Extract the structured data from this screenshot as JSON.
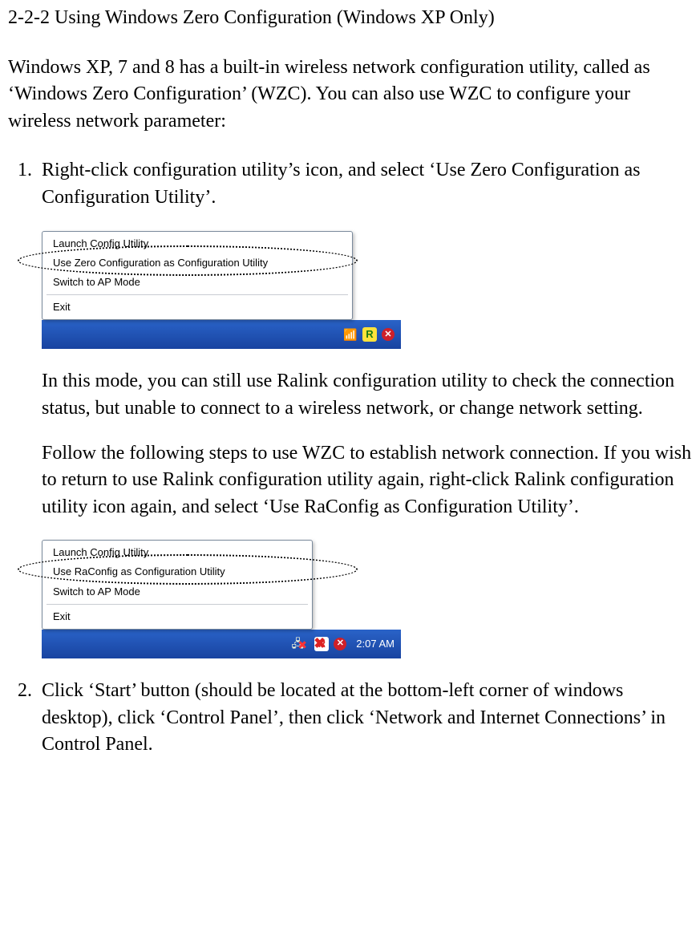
{
  "title": "2-2-2 Using Windows Zero Configuration (Windows XP Only)",
  "intro": "Windows XP, 7 and 8 has a built-in wireless network configuration utility, called as ‘Windows Zero Configuration’ (WZC). You can also use WZC to configure your wireless network parameter:",
  "steps": {
    "one": {
      "text": "Right-click configuration utility’s icon, and select ‘Use Zero Configuration as Configuration Utility’.",
      "menu": {
        "launch": "Launch Config Utility",
        "useZero": "Use Zero Configuration as Configuration Utility",
        "switchAP": "Switch to AP Mode",
        "exit": "Exit"
      },
      "tray": {
        "r_label": "R"
      },
      "after1": "In this mode, you can still use Ralink configuration utility to check the connection status, but unable to connect to a wireless network, or change network setting.",
      "after2": "Follow the following steps to use WZC to establish network connection. If you wish to return to use Ralink configuration utility again, right-click Ralink configuration utility icon again, and select ‘Use RaConfig as Configuration Utility’.",
      "menu2": {
        "launch": "Launch Config Utility",
        "useRa": "Use RaConfig as Configuration Utility",
        "switchAP": "Switch to AP Mode",
        "exit": "Exit"
      },
      "tray2": {
        "clock": "2:07 AM"
      }
    },
    "two": {
      "text": "Click ‘Start’ button (should be located at the bottom-left corner of windows desktop), click ‘Control Panel’, then click ‘Network and Internet Connections’ in Control Panel."
    }
  }
}
